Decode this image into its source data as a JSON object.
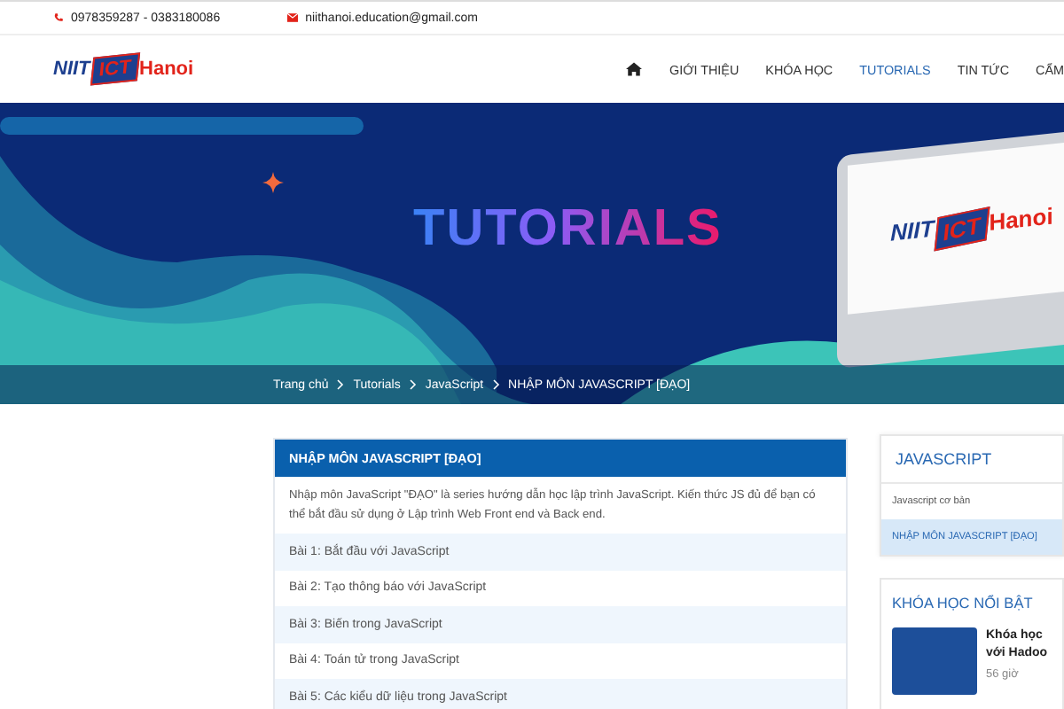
{
  "topbar": {
    "phone": "0978359287 - 0383180086",
    "email": "niithanoi.education@gmail.com"
  },
  "logo": {
    "left": "NIIT",
    "mid": "ICT",
    "right": "Hanoi"
  },
  "nav": [
    {
      "label": "GIỚI THIỆU",
      "selected": false
    },
    {
      "label": "KHÓA HỌC",
      "selected": false
    },
    {
      "label": "TUTORIALS",
      "selected": true
    },
    {
      "label": "TIN TỨC",
      "selected": false
    },
    {
      "label": "CẨM",
      "selected": false
    }
  ],
  "banner": {
    "title": "TUTORIALS",
    "monitor_logo": {
      "left": "NIIT",
      "mid": "ICT",
      "right": "Hanoi"
    }
  },
  "breadcrumb": [
    "Trang chủ",
    "Tutorials",
    "JavaScript",
    "NHẬP MÔN JAVASCRIPT [ĐẠO]"
  ],
  "series": {
    "title": "NHẬP MÔN JAVASCRIPT [ĐẠO]",
    "description": "Nhập môn JavaScript \"ĐẠO\" là series hướng dẫn học lập trình JavaScript. Kiến thức JS đủ để bạn có thể bắt đầu sử dụng ở Lập trình Web Front end và Back end.",
    "lessons": [
      "Bài 1: Bắt đầu với JavaScript",
      "Bài 2: Tạo thông báo với JavaScript",
      "Bài 3: Biến trong JavaScript",
      "Bài 4: Toán tử trong JavaScript",
      "Bài 5: Các kiểu dữ liệu trong JavaScript"
    ]
  },
  "sidebar": {
    "title": "JAVASCRIPT",
    "items": [
      {
        "label": "Javascript cơ bản",
        "selected": false
      },
      {
        "label": "NHẬP MÔN JAVASCRIPT [ĐẠO]",
        "selected": true
      }
    ]
  },
  "featured": {
    "title": "KHÓA HỌC NỔI BẬT",
    "course": {
      "title_lines": [
        "Khóa học",
        "với Hadoo"
      ],
      "duration": "56 giờ"
    }
  }
}
